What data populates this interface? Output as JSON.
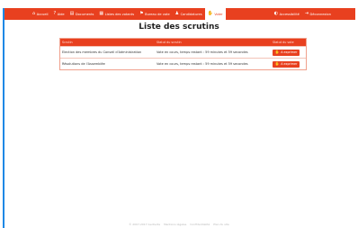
{
  "nav": {
    "items": [
      {
        "label": "Accueil",
        "icon": "home-icon",
        "glyph": "⌂"
      },
      {
        "label": "Aide",
        "icon": "help-icon",
        "glyph": "?"
      },
      {
        "label": "Documents",
        "icon": "document-icon",
        "glyph": "▤"
      },
      {
        "label": "Listes des votants",
        "icon": "voter-list-icon",
        "glyph": "▦"
      },
      {
        "label": "Bureau de vote",
        "icon": "ballot-office-icon",
        "glyph": "⚑"
      },
      {
        "label": "Candidatures",
        "icon": "candidates-icon",
        "glyph": "♟"
      },
      {
        "label": "Voter",
        "icon": "vote-icon",
        "glyph": "✋"
      }
    ],
    "right": [
      {
        "label": "Accessibilité",
        "icon": "accessibility-icon",
        "glyph": "◐"
      },
      {
        "label": "Déconnexion",
        "icon": "logout-icon",
        "glyph": "⇥"
      }
    ],
    "active_index": 6,
    "accent": "#e8401f"
  },
  "page": {
    "title": "Liste des scrutins"
  },
  "table": {
    "headers": [
      "Scrutin",
      "Statut du scrutin",
      "Statut du vote"
    ],
    "rows": [
      {
        "scrutin": "Election des membres du Conseil d'Administration",
        "statut": "Vote en cours, temps restant : 59 minutes et 59 secondes",
        "action": "A exprimer",
        "action_icon": "hand-vote-icon"
      },
      {
        "scrutin": "Résolutions de l'Assemblée",
        "statut": "Vote en cours, temps restant : 59 minutes et 59 secondes",
        "action": "A exprimer",
        "action_icon": "hand-vote-icon"
      }
    ]
  },
  "footer": {
    "copyright": "© 2007-2017 Gedivote",
    "links": [
      "Mentions légales",
      "Confidentialité",
      "Plan du site"
    ]
  }
}
